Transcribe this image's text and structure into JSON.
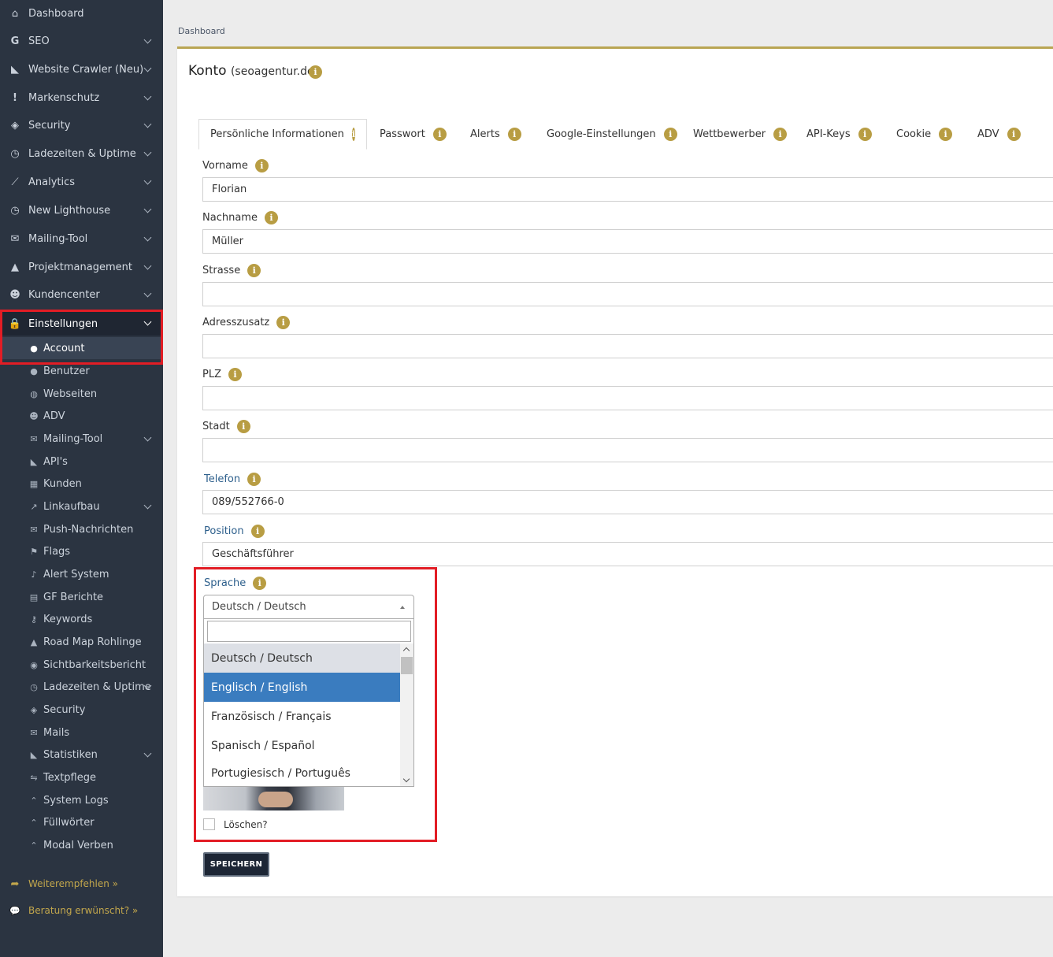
{
  "sidebar": {
    "items": [
      {
        "label": "Dashboard",
        "icon": "home-icon",
        "glyph": "⌂"
      },
      {
        "label": "SEO",
        "icon": "google-icon",
        "glyph": "G"
      },
      {
        "label": "Website Crawler (Neu)",
        "icon": "area-chart-icon",
        "glyph": "◣"
      },
      {
        "label": "Markenschutz",
        "icon": "exclamation-icon",
        "glyph": "!"
      },
      {
        "label": "Security",
        "icon": "shield-icon",
        "glyph": "◈"
      },
      {
        "label": "Ladezeiten & Uptime",
        "icon": "clock-icon",
        "glyph": "◷"
      },
      {
        "label": "Analytics",
        "icon": "line-chart-icon",
        "glyph": "⟋"
      },
      {
        "label": "New Lighthouse",
        "icon": "clock-icon",
        "glyph": "◷"
      },
      {
        "label": "Mailing-Tool",
        "icon": "envelope-icon",
        "glyph": "✉"
      },
      {
        "label": "Projektmanagement",
        "icon": "road-icon",
        "glyph": "▲"
      },
      {
        "label": "Kundencenter",
        "icon": "users-icon",
        "glyph": "☻"
      },
      {
        "label": "Einstellungen",
        "icon": "lock-icon",
        "glyph": "🔒"
      }
    ],
    "sub_items": [
      {
        "label": "Account",
        "icon": "user-icon",
        "glyph": "●"
      },
      {
        "label": "Benutzer",
        "icon": "user-icon",
        "glyph": "●"
      },
      {
        "label": "Webseiten",
        "icon": "globe-icon",
        "glyph": "◍"
      },
      {
        "label": "ADV",
        "icon": "users-icon",
        "glyph": "☻"
      },
      {
        "label": "Mailing-Tool",
        "icon": "envelope-icon",
        "glyph": "✉"
      },
      {
        "label": "API's",
        "icon": "area-chart-icon",
        "glyph": "◣"
      },
      {
        "label": "Kunden",
        "icon": "building-icon",
        "glyph": "▦"
      },
      {
        "label": "Linkaufbau",
        "icon": "external-link-icon",
        "glyph": "↗"
      },
      {
        "label": "Push-Nachrichten",
        "icon": "envelope-icon",
        "glyph": "✉"
      },
      {
        "label": "Flags",
        "icon": "flag-icon",
        "glyph": "⚑"
      },
      {
        "label": "Alert System",
        "icon": "bell-icon",
        "glyph": "♪"
      },
      {
        "label": "GF Berichte",
        "icon": "file-icon",
        "glyph": "▤"
      },
      {
        "label": "Keywords",
        "icon": "key-icon",
        "glyph": "⚷"
      },
      {
        "label": "Road Map Rohlinge",
        "icon": "road-icon",
        "glyph": "▲"
      },
      {
        "label": "Sichtbarkeitsbericht",
        "icon": "eye-icon",
        "glyph": "◉"
      },
      {
        "label": "Ladezeiten & Uptime",
        "icon": "clock-icon",
        "glyph": "◷"
      },
      {
        "label": "Security",
        "icon": "shield-icon",
        "glyph": "◈"
      },
      {
        "label": "Mails",
        "icon": "envelope-icon",
        "glyph": "✉"
      },
      {
        "label": "Statistiken",
        "icon": "area-chart-icon",
        "glyph": "◣"
      },
      {
        "label": "Textpflege",
        "icon": "handshake-icon",
        "glyph": "⇋"
      },
      {
        "label": "System Logs",
        "icon": "angle-double-up-icon",
        "glyph": "⌃"
      },
      {
        "label": "Füllwörter",
        "icon": "angle-double-up-icon",
        "glyph": "⌃"
      },
      {
        "label": "Modal Verben",
        "icon": "angle-double-up-icon",
        "glyph": "⌃"
      }
    ],
    "promo": [
      {
        "label": "Weiterempfehlen »",
        "icon": "share-icon",
        "glyph": "➦"
      },
      {
        "label": "Beratung erwünscht? »",
        "icon": "comments-icon",
        "glyph": "💬"
      }
    ]
  },
  "breadcrumb": "Dashboard",
  "page": {
    "title": "Konto",
    "subtitle": "(seoagentur.de)"
  },
  "tabs": [
    {
      "label": "Persönliche Informationen"
    },
    {
      "label": "Passwort"
    },
    {
      "label": "Alerts"
    },
    {
      "label": "Google-Einstellungen"
    },
    {
      "label": "Wettbewerber"
    },
    {
      "label": "API-Keys"
    },
    {
      "label": "Cookie"
    },
    {
      "label": "ADV"
    }
  ],
  "form": {
    "fields": [
      {
        "label": "Vorname",
        "value": "Florian"
      },
      {
        "label": "Nachname",
        "value": "Müller"
      },
      {
        "label": "Strasse",
        "value": ""
      },
      {
        "label": "Adresszusatz",
        "value": ""
      },
      {
        "label": "PLZ",
        "value": ""
      },
      {
        "label": "Stadt",
        "value": ""
      },
      {
        "label": "Telefon",
        "value": "089/552766-0"
      },
      {
        "label": "Position",
        "value": "Geschäftsführer"
      }
    ],
    "language": {
      "label": "Sprache",
      "selected": "Deutsch / Deutsch",
      "search_value": "",
      "options": [
        "Deutsch / Deutsch",
        "Englisch / English",
        "Französisch / Français",
        "Spanisch / Español",
        "Portugiesisch / Português"
      ]
    },
    "delete_label": "Löschen?",
    "save_label": "SPEICHERN"
  },
  "colors": {
    "sidebar_bg": "#2b3441",
    "accent_gold": "#b89d43",
    "highlight_red": "#e21d25",
    "option_hover": "#3a7cbf",
    "save_button": "#1d2635"
  }
}
